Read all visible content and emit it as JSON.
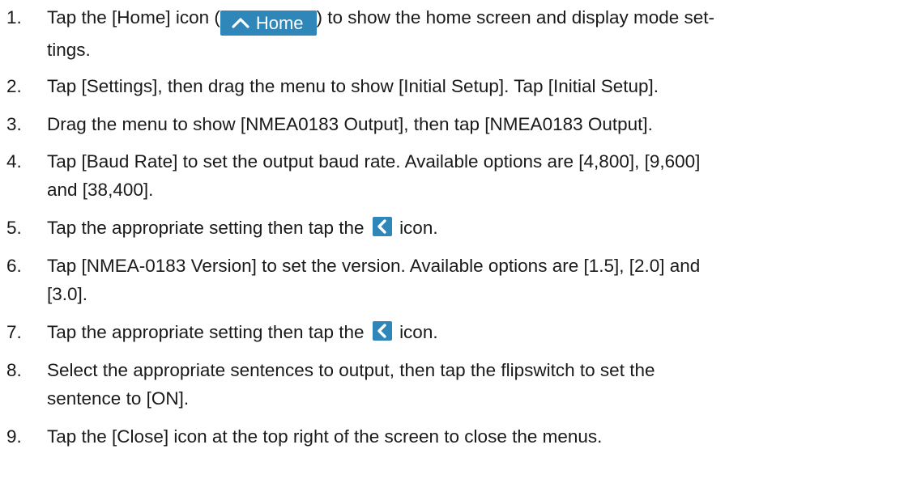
{
  "steps": [
    {
      "num": "1.",
      "before": "Tap the [Home] icon (",
      "badge_label": "Home",
      "after": ") to show the home screen and display mode set-",
      "line2": "tings."
    },
    {
      "num": "2.",
      "text": "Tap [Settings], then drag the menu to show [Initial Setup]. Tap [Initial Setup]."
    },
    {
      "num": "3.",
      "text": "Drag the menu to show [NMEA0183 Output], then tap [NMEA0183 Output]."
    },
    {
      "num": "4.",
      "line1": "Tap [Baud Rate] to set the output baud rate. Available options are [4,800], [9,600]",
      "line2": "and [38,400]."
    },
    {
      "num": "5.",
      "before": "Tap the appropriate setting then tap the",
      "after": "icon."
    },
    {
      "num": "6.",
      "line1": "Tap [NMEA-0183 Version] to set the version. Available options are [1.5], [2.0] and",
      "line2": "[3.0]."
    },
    {
      "num": "7.",
      "before": "Tap the appropriate setting then tap the",
      "after": "icon."
    },
    {
      "num": "8.",
      "line1": "Select the appropriate sentences to output, then tap the flipswitch to set the",
      "line2": "sentence to [ON]."
    },
    {
      "num": "9.",
      "text": "Tap the [Close] icon at the top right of the screen to close the menus."
    }
  ],
  "icons": {
    "home": "home-icon",
    "back": "back-chevron-icon"
  },
  "colors": {
    "home_badge": "#2f86b8",
    "back_icon": "#2f86b8"
  }
}
